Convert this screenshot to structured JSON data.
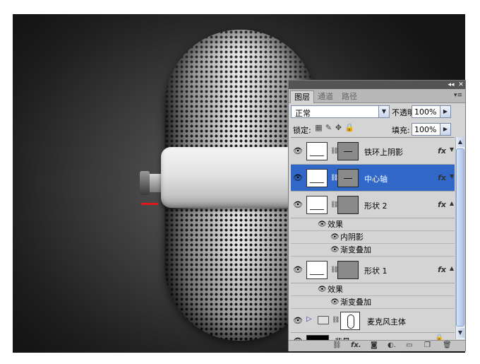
{
  "tabs": [
    "图层",
    "通道",
    "路径"
  ],
  "blend_mode": "正常",
  "opacity_label": "不透明度:",
  "opacity_value": "100%",
  "lock_label": "锁定:",
  "fill_label": "填充:",
  "fill_value": "100%",
  "layers": [
    {
      "name": "铁环上阴影",
      "fx": "fx"
    },
    {
      "name": "中心轴",
      "fx": "fx"
    },
    {
      "name": "形状 2",
      "fx": "fx",
      "effects_label": "效果",
      "effects": [
        "内阴影",
        "渐变叠加"
      ]
    },
    {
      "name": "形状 1",
      "fx": "fx",
      "effects_label": "效果",
      "effects": [
        "渐变叠加"
      ]
    },
    {
      "name": "麦克风主体"
    },
    {
      "name": "背景"
    }
  ],
  "icons": {
    "visibility": "eye-icon",
    "link": "chain-link-icon",
    "folder": "folder-icon",
    "lock": "lock-icon"
  },
  "colors": {
    "selection": "#3168c8",
    "marker": "#e01818"
  }
}
